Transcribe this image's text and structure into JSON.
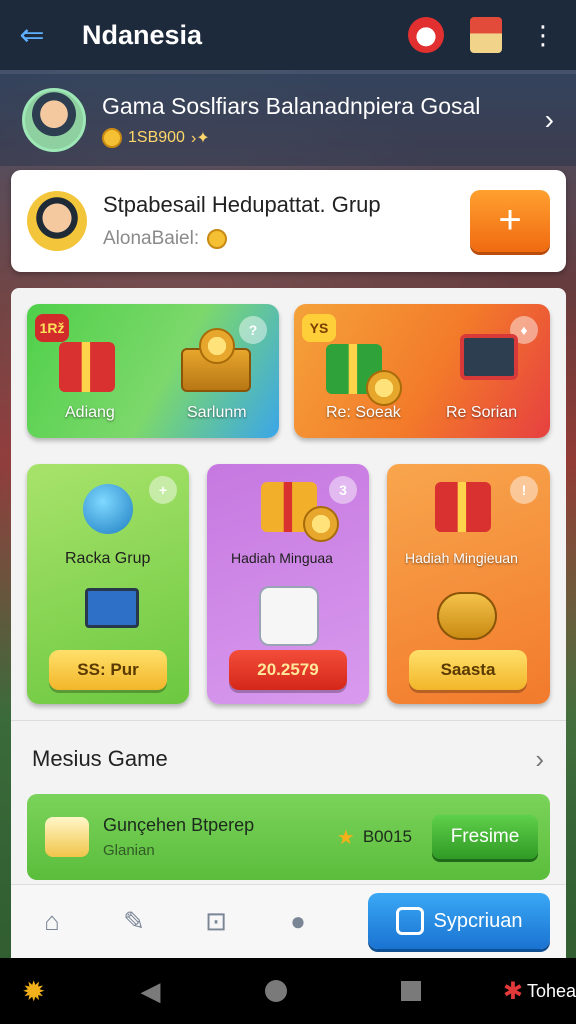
{
  "topbar": {
    "title": "Ndanesia"
  },
  "profile": {
    "name": "Gama Soslfiars Balanadnpiera Gosal",
    "coins": "1SB900"
  },
  "group": {
    "name": "Stpabesail Hedupattat. Grup",
    "sub": "AlonaBaiel:",
    "add_label": "+"
  },
  "tiles": {
    "t1": {
      "badge": "1Rž",
      "left_label": "Adiang",
      "right_label": "Sarlunm"
    },
    "t2": {
      "badge": "YS",
      "left_label": "Re: Soeak",
      "right_label": "Re Sorian"
    },
    "t3": {
      "title": "Racka Grup",
      "button": "SS: Pur"
    },
    "t4": {
      "badge": "3",
      "title": "Hadiah Minguaa",
      "button": "20.2579"
    },
    "t5": {
      "title": "Hadiah Mingieuan",
      "button": "Saasta"
    }
  },
  "more_games": {
    "title": "Mesius Game",
    "game": {
      "name": "Gunçehen Btperep",
      "sub": "Glanian",
      "score": "B0015",
      "button": "Fresime"
    }
  },
  "tabbar": {
    "cta_label": "Sypcriuan"
  },
  "navbar": {
    "right_label": "Tohea"
  },
  "colors": {
    "accent": "#f06a10",
    "cta": "#1a73d1",
    "topbar": "#1d2a3b"
  }
}
